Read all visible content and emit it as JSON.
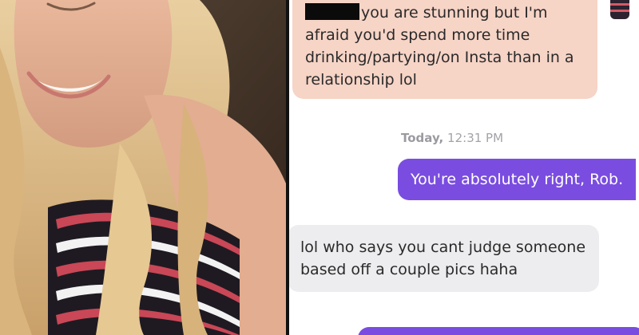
{
  "chat": {
    "messages": [
      {
        "text": "you are stunning but I'm afraid you'd spend more time drinking/partying/on Insta than in a relationship lol"
      },
      {
        "text": "You're absolutely right, Rob."
      },
      {
        "text": "lol who says you cant judge someone based off a couple pics haha"
      }
    ],
    "timestamp": {
      "day": "Today,",
      "time": "12:31 PM"
    }
  },
  "colors": {
    "incoming_peach": "#f6d4c6",
    "incoming_gray": "#ededef",
    "outgoing_purple": "#7a4de0",
    "timestamp": "#a3a3a8"
  }
}
